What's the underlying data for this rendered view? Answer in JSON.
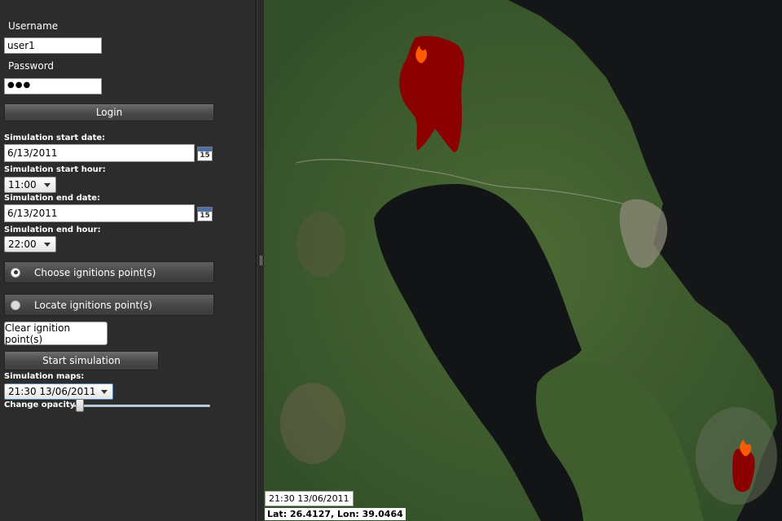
{
  "login": {
    "username_label": "Username",
    "username_value": "user1",
    "password_label": "Password",
    "password_value": "●●●",
    "login_button": "Login"
  },
  "simulation": {
    "start_date_label": "Simulation start date:",
    "start_date_value": "6/13/2011",
    "start_hour_label": "Simulation start hour:",
    "start_hour_value": "11:00",
    "end_date_label": "Simulation end date:",
    "end_date_value": "6/13/2011",
    "end_hour_label": "Simulation end hour:",
    "end_hour_value": "22:00",
    "calendar_day": "15"
  },
  "ignition": {
    "choose_label": "Choose ignitions point(s)",
    "locate_label": "Locate ignitions point(s)",
    "clear_button": "Clear ignition point(s)",
    "start_button": "Start simulation"
  },
  "maps": {
    "label": "Simulation maps:",
    "selected": "21:30 13/06/2011",
    "opacity_label": "Change opacity",
    "opacity_value": 0.05
  },
  "map_overlay": {
    "timestamp": "21:30 13/06/2011",
    "coords": "Lat: 26.4127, Lon: 39.0464"
  },
  "icons": {
    "calendar": "calendar-icon",
    "fire": "fire-icon"
  },
  "colors": {
    "burn_area": "#8b0000",
    "fire": "#ff5a00",
    "sea": "#131517",
    "land": "#3e5a2c"
  }
}
